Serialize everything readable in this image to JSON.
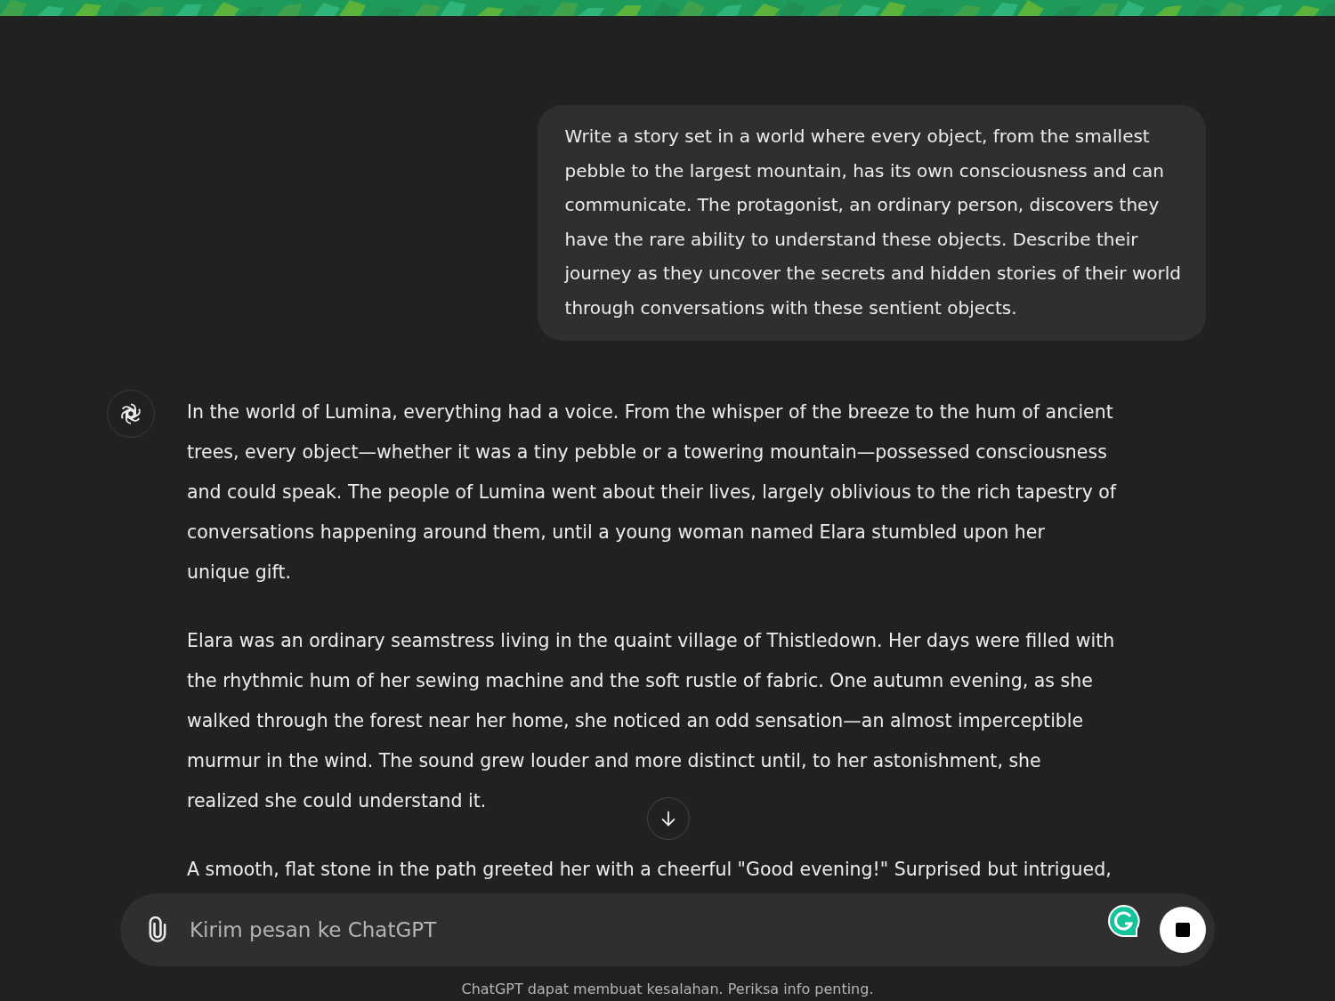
{
  "user_message": {
    "lines": [
      "Write a story set in a world where every object, from the smallest",
      "pebble to the largest mountain, has its own consciousness and can",
      "communicate. The protagonist, an ordinary person, discovers they",
      "have the rare ability to understand these objects. Describe their",
      "journey as they uncover the secrets and hidden stories of their world",
      "through conversations with these sentient objects."
    ]
  },
  "assistant_message": {
    "paragraphs": [
      {
        "lines": [
          "In the world of Lumina, everything had a voice. From the whisper of the breeze to the hum of ancient",
          "trees, every object—whether it was a tiny pebble or a towering mountain—possessed consciousness",
          "and could speak. The people of Lumina went about their lives, largely oblivious to the rich tapestry of",
          "conversations happening around them, until a young woman named Elara stumbled upon her",
          "unique gift."
        ]
      },
      {
        "lines": [
          "Elara was an ordinary seamstress living in the quaint village of Thistledown. Her days were filled with",
          "the rhythmic hum of her sewing machine and the soft rustle of fabric. One autumn evening, as she",
          "walked through the forest near her home, she noticed an odd sensation—an almost imperceptible",
          "murmur in the wind. The sound grew louder and more distinct until, to her astonishment, she",
          "realized she could understand it."
        ]
      },
      {
        "lines": [
          "A smooth, flat stone in the path greeted her with a cheerful \"Good evening!\" Surprised but intrigued,"
        ]
      }
    ]
  },
  "composer": {
    "placeholder": "Kirim pesan ke ChatGPT",
    "generating": true
  },
  "footer": "ChatGPT dapat membuat kesalahan. Periksa info penting."
}
